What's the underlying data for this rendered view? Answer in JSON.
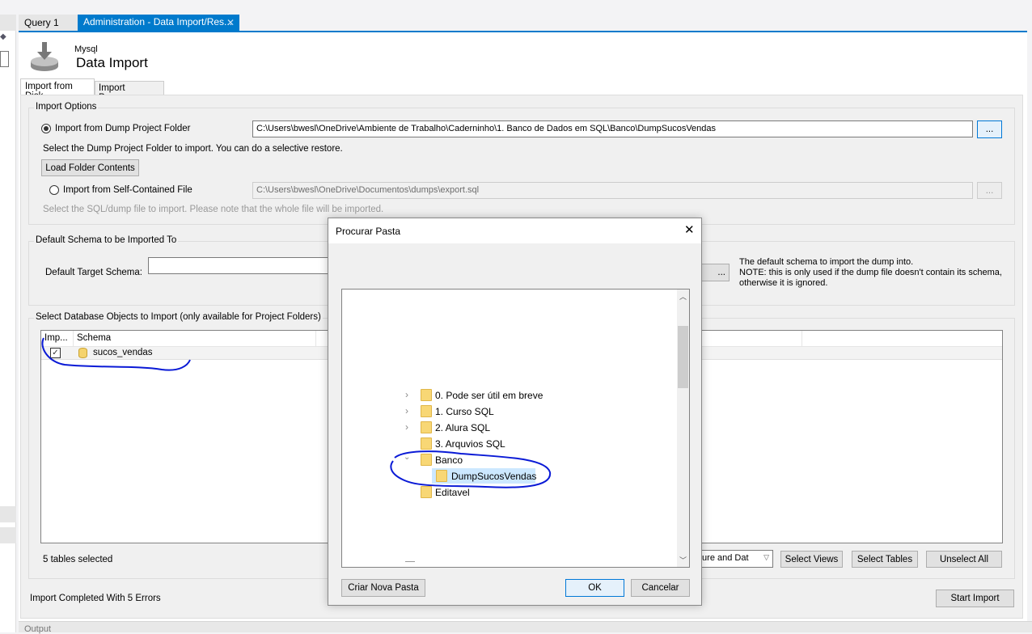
{
  "tabs": [
    {
      "label": "Query 1",
      "active": false
    },
    {
      "label": "Administration - Data Import/Res...",
      "active": true
    }
  ],
  "header": {
    "subtitle": "Mysql",
    "title": "Data Import",
    "icon": "import-disk-icon"
  },
  "subtabs": [
    {
      "label": "Import from Disk",
      "active": true
    },
    {
      "label": "Import Progress",
      "active": false
    }
  ],
  "import_options": {
    "label": "Import Options",
    "dump_folder_radio": "Import from Dump Project Folder",
    "dump_folder_path": "C:\\Users\\bwesl\\OneDrive\\Ambiente de Trabalho\\Caderninho\\1. Banco de Dados em SQL\\Banco\\DumpSucosVendas",
    "browse_label": "...",
    "dump_folder_hint": "Select the Dump Project Folder to import. You can do a selective restore.",
    "load_button": "Load Folder Contents",
    "file_radio": "Import from Self-Contained File",
    "file_path": "C:\\Users\\bwesl\\OneDrive\\Documentos\\dumps\\export.sql",
    "file_hint": "Select the SQL/dump file to import. Please note that the whole file will be imported."
  },
  "default_schema": {
    "label": "Default Schema to be Imported To",
    "field_label": "Default Target Schema:",
    "value": "",
    "new_button": "...",
    "note1": "The default schema to import the dump into.",
    "note2": "NOTE: this is only used if the dump file doesn't contain its schema,",
    "note3": "otherwise it is ignored."
  },
  "objects": {
    "label": "Select Database Objects to Import (only available for Project Folders)",
    "columns": [
      "Imp...",
      "Schema"
    ],
    "rows": [
      {
        "checked": true,
        "schema": "sucos_vendas"
      }
    ],
    "selected_count": "5 tables selected",
    "dump_type": "ture and Dat",
    "select_views": "Select Views",
    "select_tables": "Select Tables",
    "unselect_all": "Unselect All"
  },
  "status": "Import Completed With 5 Errors",
  "start_import": "Start Import",
  "output_label": "Output",
  "dialog": {
    "title": "Procurar Pasta",
    "tree": [
      {
        "label": "0. Pode ser útil em breve",
        "expander": "collapsed",
        "level": 0
      },
      {
        "label": "1. Curso SQL",
        "expander": "collapsed",
        "level": 0
      },
      {
        "label": "2. Alura SQL",
        "expander": "collapsed",
        "level": 0
      },
      {
        "label": "3. Arquvios SQL",
        "expander": "none",
        "level": 0
      },
      {
        "label": "Banco",
        "expander": "expanded",
        "level": 0
      },
      {
        "label": "DumpSucosVendas",
        "expander": "none",
        "level": 1,
        "selected": true
      },
      {
        "label": "Editavel",
        "expander": "none",
        "level": 0
      }
    ],
    "new_folder": "Criar Nova Pasta",
    "ok": "OK",
    "cancel": "Cancelar"
  },
  "colors": {
    "accent": "#007acc",
    "selection": "#cce8ff",
    "annotation": "#0a1ad6"
  }
}
